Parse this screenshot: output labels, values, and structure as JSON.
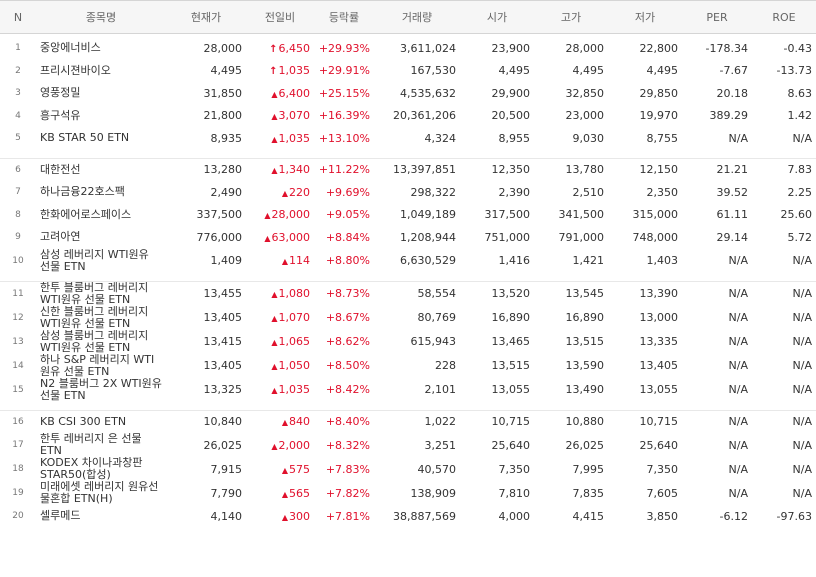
{
  "headers": {
    "n": "N",
    "name": "종목명",
    "price": "현재가",
    "change": "전일비",
    "rate": "등락률",
    "volume": "거래량",
    "open": "시가",
    "high": "고가",
    "low": "저가",
    "per": "PER",
    "roe": "ROE"
  },
  "colors": {
    "up": "#e0102c",
    "header_bg": "#f6f6f6"
  },
  "groups": [
    [
      {
        "n": "1",
        "name": "중앙에너비스",
        "price": "28,000",
        "ceiling": true,
        "change": "6,450",
        "rate": "+29.93%",
        "volume": "3,611,024",
        "open": "23,900",
        "high": "28,000",
        "low": "22,800",
        "per": "-178.34",
        "roe": "-0.43"
      },
      {
        "n": "2",
        "name": "프리시젼바이오",
        "price": "4,495",
        "ceiling": true,
        "change": "1,035",
        "rate": "+29.91%",
        "volume": "167,530",
        "open": "4,495",
        "high": "4,495",
        "low": "4,495",
        "per": "-7.67",
        "roe": "-13.73"
      },
      {
        "n": "3",
        "name": "영풍정밀",
        "price": "31,850",
        "ceiling": false,
        "change": "6,400",
        "rate": "+25.15%",
        "volume": "4,535,632",
        "open": "29,900",
        "high": "32,850",
        "low": "29,850",
        "per": "20.18",
        "roe": "8.63"
      },
      {
        "n": "4",
        "name": "흥구석유",
        "price": "21,800",
        "ceiling": false,
        "change": "3,070",
        "rate": "+16.39%",
        "volume": "20,361,206",
        "open": "20,500",
        "high": "23,000",
        "low": "19,970",
        "per": "389.29",
        "roe": "1.42"
      },
      {
        "n": "5",
        "name": "KB STAR 50 ETN",
        "price": "8,935",
        "ceiling": false,
        "change": "1,035",
        "rate": "+13.10%",
        "volume": "4,324",
        "open": "8,955",
        "high": "9,030",
        "low": "8,755",
        "per": "N/A",
        "roe": "N/A"
      }
    ],
    [
      {
        "n": "6",
        "name": "대한전선",
        "price": "13,280",
        "ceiling": false,
        "change": "1,340",
        "rate": "+11.22%",
        "volume": "13,397,851",
        "open": "12,350",
        "high": "13,780",
        "low": "12,150",
        "per": "21.21",
        "roe": "7.83"
      },
      {
        "n": "7",
        "name": "하나금융22호스팩",
        "price": "2,490",
        "ceiling": false,
        "change": "220",
        "rate": "+9.69%",
        "volume": "298,322",
        "open": "2,390",
        "high": "2,510",
        "low": "2,350",
        "per": "39.52",
        "roe": "2.25"
      },
      {
        "n": "8",
        "name": "한화에어로스페이스",
        "price": "337,500",
        "ceiling": false,
        "change": "28,000",
        "rate": "+9.05%",
        "volume": "1,049,189",
        "open": "317,500",
        "high": "341,500",
        "low": "315,000",
        "per": "61.11",
        "roe": "25.60"
      },
      {
        "n": "9",
        "name": "고려아연",
        "price": "776,000",
        "ceiling": false,
        "change": "63,000",
        "rate": "+8.84%",
        "volume": "1,208,944",
        "open": "751,000",
        "high": "791,000",
        "low": "748,000",
        "per": "29.14",
        "roe": "5.72"
      },
      {
        "n": "10",
        "name": "삼성 레버리지 WTI원유 선물 ETN",
        "price": "1,409",
        "ceiling": false,
        "change": "114",
        "rate": "+8.80%",
        "volume": "6,630,529",
        "open": "1,416",
        "high": "1,421",
        "low": "1,403",
        "per": "N/A",
        "roe": "N/A"
      }
    ],
    [
      {
        "n": "11",
        "name": "한투 블룸버그 레버리지 WTI원유 선물 ETN",
        "price": "13,455",
        "ceiling": false,
        "change": "1,080",
        "rate": "+8.73%",
        "volume": "58,554",
        "open": "13,520",
        "high": "13,545",
        "low": "13,390",
        "per": "N/A",
        "roe": "N/A"
      },
      {
        "n": "12",
        "name": "신한 블룸버그 레버리지 WTI원유 선물 ETN",
        "price": "13,405",
        "ceiling": false,
        "change": "1,070",
        "rate": "+8.67%",
        "volume": "80,769",
        "open": "16,890",
        "high": "16,890",
        "low": "13,000",
        "per": "N/A",
        "roe": "N/A"
      },
      {
        "n": "13",
        "name": "삼성 블룸버그 레버리지 WTI원유 선물 ETN",
        "price": "13,415",
        "ceiling": false,
        "change": "1,065",
        "rate": "+8.62%",
        "volume": "615,943",
        "open": "13,465",
        "high": "13,515",
        "low": "13,335",
        "per": "N/A",
        "roe": "N/A"
      },
      {
        "n": "14",
        "name": "하나 S&P 레버리지 WTI원유 선물 ETN",
        "price": "13,405",
        "ceiling": false,
        "change": "1,050",
        "rate": "+8.50%",
        "volume": "228",
        "open": "13,515",
        "high": "13,590",
        "low": "13,405",
        "per": "N/A",
        "roe": "N/A"
      },
      {
        "n": "15",
        "name": "N2 블룸버그 2X WTI원유선물 ETN",
        "price": "13,325",
        "ceiling": false,
        "change": "1,035",
        "rate": "+8.42%",
        "volume": "2,101",
        "open": "13,055",
        "high": "13,490",
        "low": "13,055",
        "per": "N/A",
        "roe": "N/A"
      }
    ],
    [
      {
        "n": "16",
        "name": "KB CSI 300 ETN",
        "price": "10,840",
        "ceiling": false,
        "change": "840",
        "rate": "+8.40%",
        "volume": "1,022",
        "open": "10,715",
        "high": "10,880",
        "low": "10,715",
        "per": "N/A",
        "roe": "N/A"
      },
      {
        "n": "17",
        "name": "한투 레버리지 은 선물 ETN",
        "price": "26,025",
        "ceiling": false,
        "change": "2,000",
        "rate": "+8.32%",
        "volume": "3,251",
        "open": "25,640",
        "high": "26,025",
        "low": "25,640",
        "per": "N/A",
        "roe": "N/A"
      },
      {
        "n": "18",
        "name": "KODEX 차이나과창판 STAR50(합성)",
        "price": "7,915",
        "ceiling": false,
        "change": "575",
        "rate": "+7.83%",
        "volume": "40,570",
        "open": "7,350",
        "high": "7,995",
        "low": "7,350",
        "per": "N/A",
        "roe": "N/A"
      },
      {
        "n": "19",
        "name": "미래에셋 레버리지 원유선물혼합 ETN(H)",
        "price": "7,790",
        "ceiling": false,
        "change": "565",
        "rate": "+7.82%",
        "volume": "138,909",
        "open": "7,810",
        "high": "7,835",
        "low": "7,605",
        "per": "N/A",
        "roe": "N/A"
      },
      {
        "n": "20",
        "name": "셀루메드",
        "price": "4,140",
        "ceiling": false,
        "change": "300",
        "rate": "+7.81%",
        "volume": "38,887,569",
        "open": "4,000",
        "high": "4,415",
        "low": "3,850",
        "per": "-6.12",
        "roe": "-97.63"
      }
    ]
  ]
}
